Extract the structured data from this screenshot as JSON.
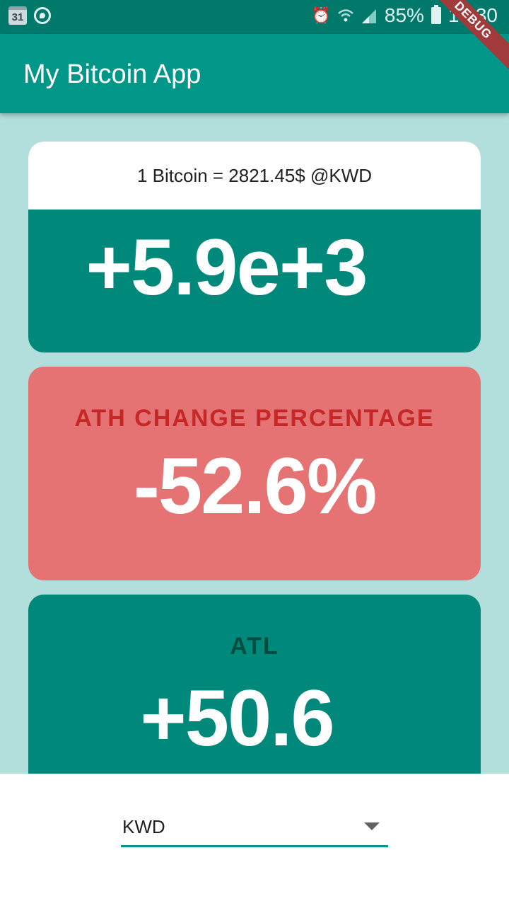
{
  "status_bar": {
    "calendar_day": "31",
    "icons": [
      "calendar-icon",
      "whatsapp-icon",
      "alarm-icon",
      "wifi-icon",
      "signal-icon",
      "battery-icon"
    ],
    "battery": "85%",
    "time": "16:30"
  },
  "debug_banner": "DEBUG",
  "app_bar": {
    "title": "My Bitcoin App"
  },
  "rate_card": {
    "header": "1 Bitcoin = 2821.45$ @KWD",
    "value": "+5.9e+3"
  },
  "ath_card": {
    "label": "ATH CHANGE PERCENTAGE",
    "value": "-52.6%"
  },
  "atl_card": {
    "label": "ATL",
    "value": "+50.6"
  },
  "currency_dropdown": {
    "selected": "KWD"
  },
  "colors": {
    "primary": "#009688",
    "status_bar": "#00796b",
    "background": "#b2dfdb",
    "card_teal": "#00897b",
    "card_red": "#e57373",
    "label_red": "#c62828",
    "label_dark_teal": "#004d40"
  }
}
